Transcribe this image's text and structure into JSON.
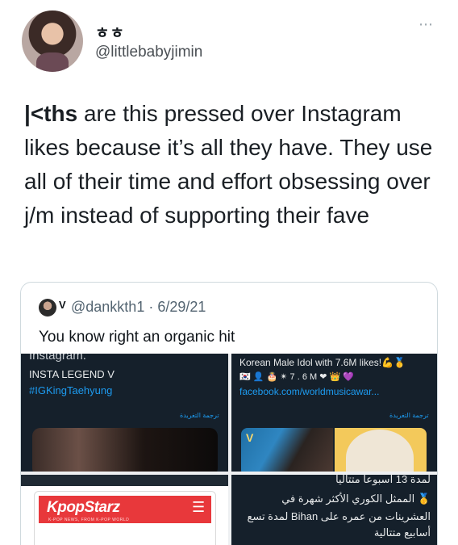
{
  "author": {
    "display_name": "ㅎㅎ",
    "handle": "@littlebabyjimin"
  },
  "more_icon": "⋯",
  "tweet": {
    "bold_prefix": "|<ths",
    "text_rest": " are this pressed over Instagram likes because it’s all they have. They use all of their time and effort obsessing over j/m instead of supporting their fave"
  },
  "quote": {
    "verified_mark": "V",
    "handle_date": "@dankkth1 · 6/29/21",
    "text": "You know right an organic hit",
    "cells": {
      "c1": {
        "cut_text": "Instagram.",
        "line1": "INSTA LEGEND V",
        "line2": "#IGKingTaehyung",
        "translate": "ترجمة التغريدة"
      },
      "c2": {
        "line1": "Korean Male Idol with 7.6M likes!💪🥇",
        "emojis": "🇰🇷 👤 🎂 ✴ 7 . 6 M ❤ 👑 💜",
        "line2": "facebook.com/worldmusicawar...",
        "translate": "ترجمة التغريدة",
        "photo_letter": "V"
      },
      "c3": {
        "logo": "KpopStarz",
        "logo_sub": "K-POP NEWS, FROM K-POP WORLD",
        "menu_icon": "☰"
      },
      "c4": {
        "line1": "لمدة 13 أسبوعا متتاليا",
        "line2": "🥇 الممثل الكوري الأكثر شهرة في",
        "line3": "العشرينات من عمره على Bihan لمدة تسع",
        "line4": "أسابيع متتالية"
      }
    }
  },
  "colors": {
    "link_blue": "#1d9bf0",
    "tweet_dark_bg": "#15202b",
    "kpopstarz_red": "#e8383b"
  }
}
